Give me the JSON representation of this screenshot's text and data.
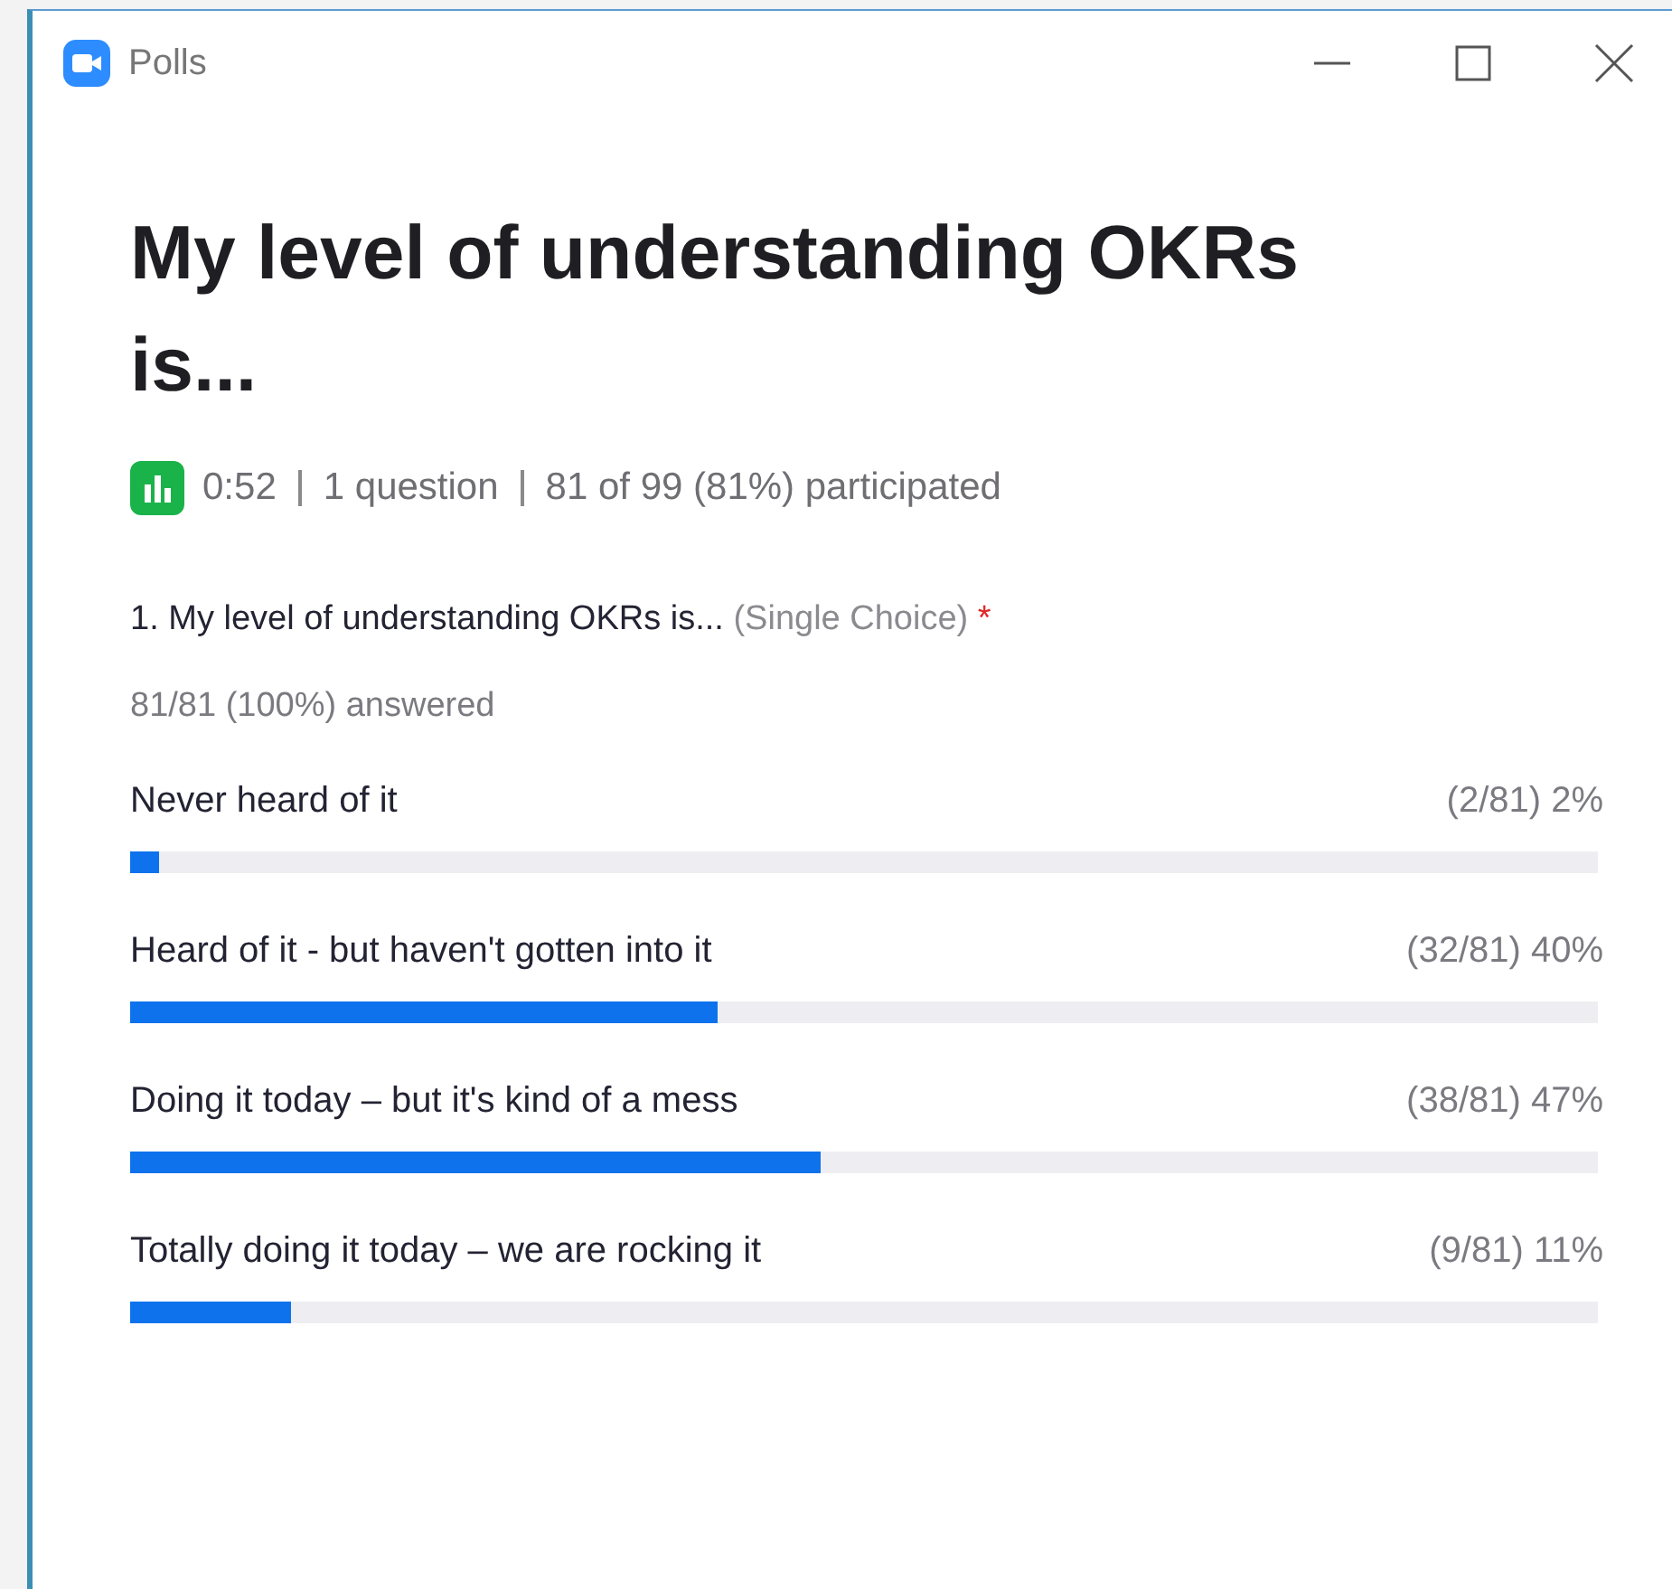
{
  "window": {
    "title": "Polls"
  },
  "poll": {
    "title": "My level of understanding OKRs is...",
    "meta": [
      "0:52",
      "1 question",
      "81 of 99 (81%) participated"
    ]
  },
  "question": {
    "text": "1. My level of understanding OKRs is...",
    "type": "(Single Choice)",
    "required_mark": "*",
    "answered": "81/81 (100%) answered"
  },
  "options": [
    {
      "label": "Never heard of it",
      "result": "(2/81) 2%",
      "level": 0.02
    },
    {
      "label": "Heard of it - but haven't gotten into it",
      "result": "(32/81) 40%",
      "level": 0.4
    },
    {
      "label": "Doing it today – but it's kind of a mess",
      "result": "(38/81) 47%",
      "level": 0.47
    },
    {
      "label": "Totally doing it today – we are rocking it",
      "result": "(9/81) 11%",
      "level": 0.11
    }
  ]
}
